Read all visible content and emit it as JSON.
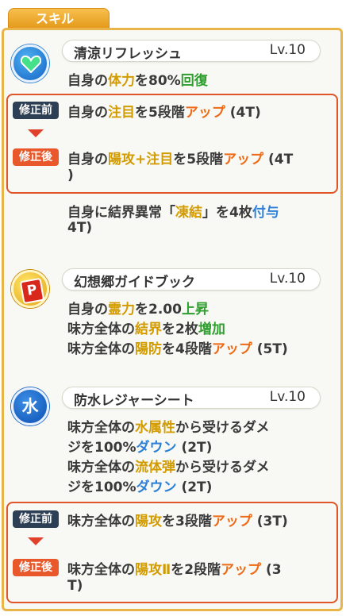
{
  "tab_label": "スキル",
  "skills": [
    {
      "name": "清涼リフレッシュ",
      "level": "Lv.10",
      "icon": "heart-icon",
      "lines": [
        [
          "自身の",
          "体力",
          "を80%",
          "回復"
        ]
      ],
      "change": {
        "before_label": "修正前",
        "after_label": "修正後",
        "before": [
          "自身の",
          "注目",
          "を5段階",
          "アップ",
          " (4T)"
        ],
        "after_line1": [
          "自身の",
          "陽攻+注目",
          "を5段階",
          "アップ",
          " (4T"
        ],
        "after_line2": ")"
      },
      "extra_line1": [
        "自身に結界異常「",
        "凍結",
        "」を4枚",
        "付与"
      ],
      "extra_line2": "4T)"
    },
    {
      "name": "幻想郷ガイドブック",
      "level": "Lv.10",
      "icon": "p-item-icon",
      "icon_text": "P",
      "lines": [
        [
          "自身の",
          "霊力",
          "を2.00",
          "上昇"
        ],
        [
          "味方全体の",
          "結界",
          "を2枚",
          "増加"
        ],
        [
          "味方全体の",
          "陽防",
          "を4段階",
          "アップ",
          " (5T)"
        ]
      ]
    },
    {
      "name": "防水レジャーシート",
      "level": "Lv.10",
      "icon": "water-icon",
      "icon_text": "水",
      "lines": [
        [
          "味方全体の",
          "水属性",
          "から受けるダメ"
        ],
        [
          "ジを100%",
          "ダウン",
          " (2T)"
        ],
        [
          "味方全体の",
          "流体弾",
          "から受けるダメ"
        ],
        [
          "ジを100%",
          "ダウン",
          " (2T)"
        ]
      ],
      "change": {
        "before_label": "修正前",
        "after_label": "修正後",
        "before": [
          "味方全体の",
          "陽攻",
          "を3段階",
          "アップ",
          " (3T)"
        ],
        "after_line1": [
          "味方全体の",
          "陽攻Ⅱ",
          "を2段階",
          "アップ",
          " (3"
        ],
        "after_line2": "T)"
      }
    }
  ],
  "colors": {
    "keyword": "#d29b00",
    "green": "#2e9e2e",
    "orange": "#ee6a15",
    "blue": "#2b7fd6",
    "panel_border": "#e9b44a",
    "change_border": "#e0542a"
  }
}
